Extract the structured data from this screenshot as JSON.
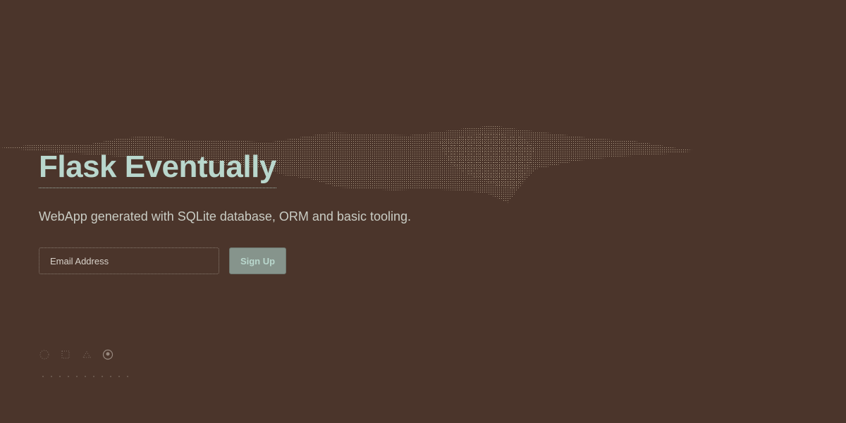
{
  "hero": {
    "title": "Flask Eventually",
    "subtitle": "WebApp generated with SQLite database, ORM and basic tooling."
  },
  "signup": {
    "email_placeholder": "Email Address",
    "button_label": "Sign Up"
  },
  "footer": {
    "icons": [
      "social-icon",
      "social-icon",
      "social-icon",
      "github-icon"
    ]
  },
  "colors": {
    "background": "#4b352b",
    "accent": "#b9d7cd",
    "button": "#86948c"
  }
}
